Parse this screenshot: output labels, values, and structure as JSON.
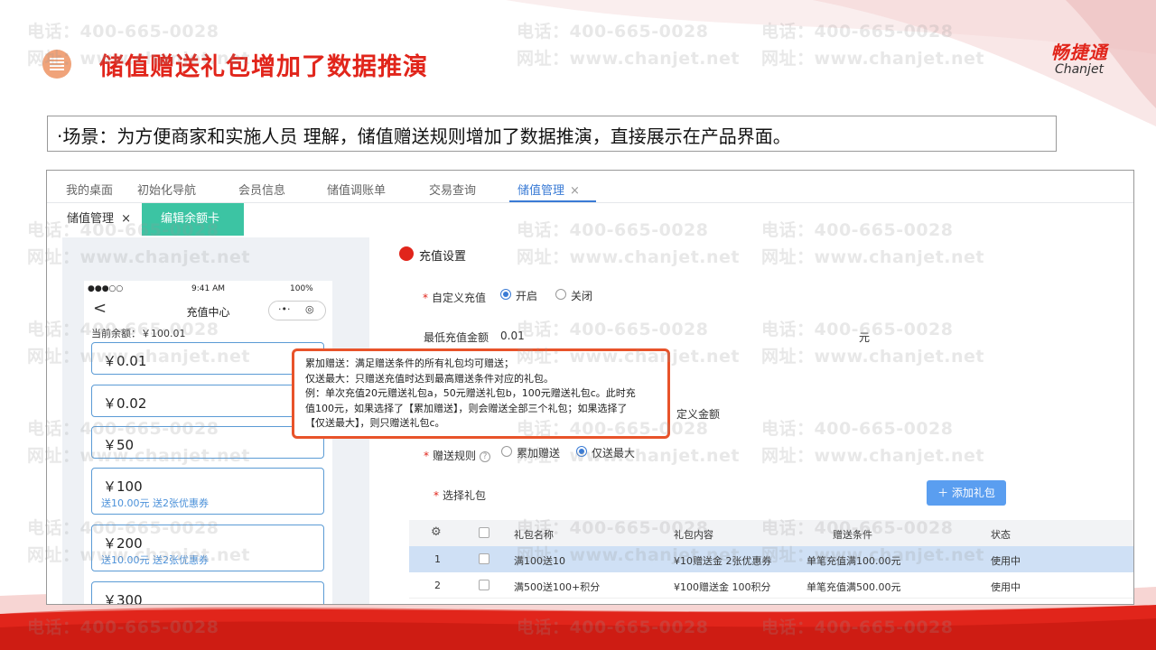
{
  "header": {
    "title": "储值赠送礼包增加了数据推演",
    "logo_cn": "畅捷通",
    "logo_en": "Chanjet"
  },
  "scene": "·场景：为方便商家和实施人员 理解，储值赠送规则增加了数据推演，直接展示在产品界面。",
  "watermark": {
    "phone": "电话：400-665-0028",
    "site": "网址：www.chanjet.net"
  },
  "topnav": {
    "items": [
      "我的桌面",
      "初始化导航",
      "会员信息",
      "储值调账单",
      "交易查询",
      "储值管理"
    ],
    "close": "×"
  },
  "subtabs": {
    "items": [
      "储值管理",
      "编辑余额卡"
    ],
    "close": "×"
  },
  "phone": {
    "signal": "●●●○○",
    "time": "9:41 AM",
    "battery": "100%",
    "back": "<",
    "title": "充值中心",
    "capsule_dots": "·•·",
    "capsule_circle": "◎",
    "balance": "当前余额：￥100.01",
    "amounts": [
      {
        "value": "￥0.01",
        "sub": ""
      },
      {
        "value": "￥0.02",
        "sub": ""
      },
      {
        "value": "￥50",
        "sub": ""
      },
      {
        "value": "￥100",
        "sub": "送10.00元 送2张优惠券"
      },
      {
        "value": "￥200",
        "sub": "送10.00元 送2张优惠券"
      },
      {
        "value": "￥300",
        "sub": ""
      }
    ]
  },
  "form": {
    "section_title": "充值设置",
    "custom_recharge_label": "自定义充值",
    "on_label": "开启",
    "off_label": "关闭",
    "min_amount_label": "最低充值金额",
    "min_amount_value": "0.01",
    "unit_yuan": "元",
    "custom_amount_fragment": "定义金额",
    "gift_rule_label": "赠送规则",
    "rule_cumulative": "累加赠送",
    "rule_max_only": "仅送最大",
    "choose_gift_label": "选择礼包",
    "add_gift_button": "＋ 添加礼包",
    "required_mark": "*",
    "help": "?"
  },
  "table": {
    "headers": [
      "礼包名称",
      "礼包内容",
      "赠送条件",
      "状态"
    ],
    "gear": "⚙",
    "rows": [
      {
        "index": "1",
        "name": "满100送10",
        "content": "¥10赠送金 2张优惠券",
        "condition": "单笔充值满100.00元",
        "status": "使用中"
      },
      {
        "index": "2",
        "name": "满500送100+积分",
        "content": "¥100赠送金 100积分",
        "condition": "单笔充值满500.00元",
        "status": "使用中"
      }
    ]
  },
  "callout": {
    "lines": [
      "累加赠送：满足赠送条件的所有礼包均可赠送；",
      "仅送最大：只赠送充值时达到最高赠送条件对应的礼包。",
      "例：单次充值20元赠送礼包a，50元赠送礼包b，100元赠送礼包c。此时充",
      "值100元，如果选择了【累加赠送】，则会赠送全部三个礼包；如果选择了",
      "【仅送最大】，则只赠送礼包c。"
    ]
  },
  "colors": {
    "brand_red": "#e1251b",
    "accent_blue": "#3a7bd5",
    "tab_green": "#3cc4a3",
    "callout_border": "#e8532a"
  }
}
